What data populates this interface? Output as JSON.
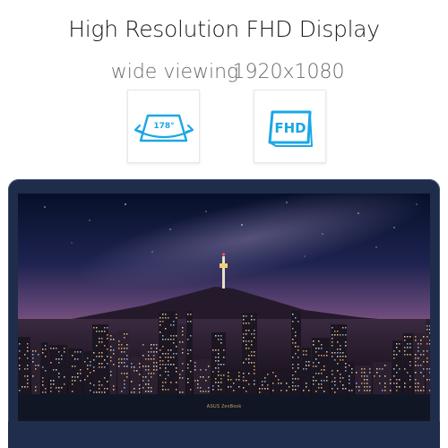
{
  "headline": "High Resolution FHD Display",
  "features": [
    {
      "label": "wide viewing",
      "icon_text": "178°",
      "icon": "viewing-angle-icon"
    },
    {
      "label": "1920x1080",
      "icon_text": "FHD",
      "icon": "fhd-icon"
    }
  ],
  "laptop": {
    "brand": "ASUS ZenBook",
    "screen_image": "night-city-skyline-photo"
  },
  "colors": {
    "accent": "#1aa7e6",
    "bezel": "#1f2c4a",
    "brand_gold": "#c8a552",
    "text": "#1a1a1a",
    "label_gray": "#6b6b6b"
  }
}
